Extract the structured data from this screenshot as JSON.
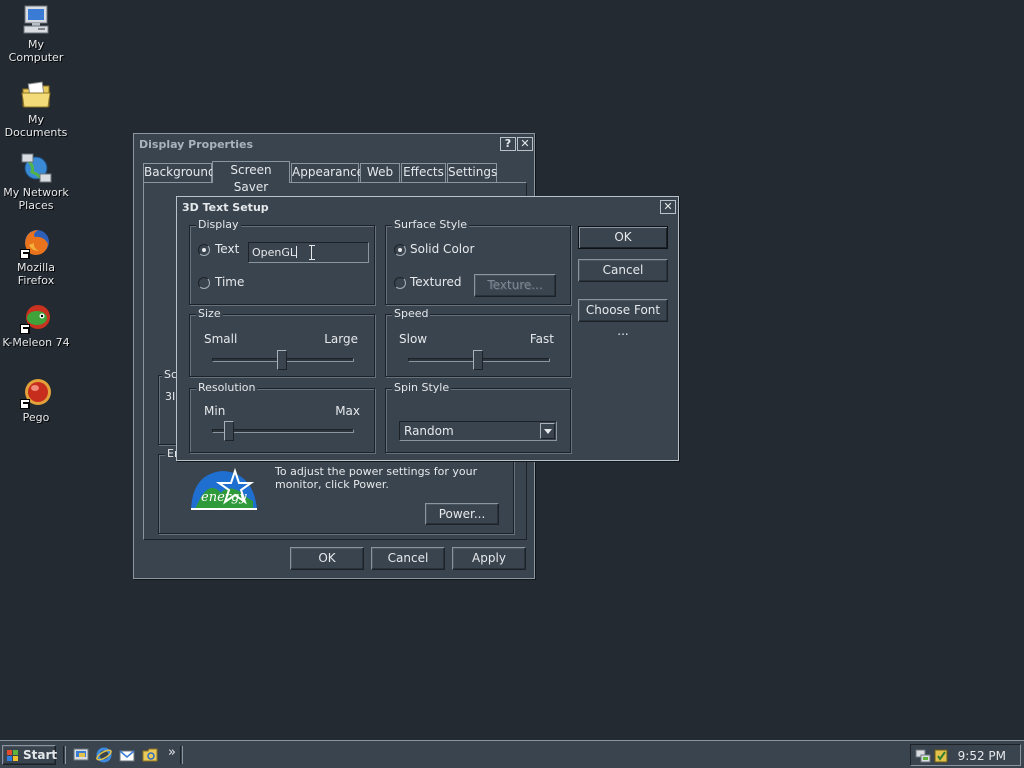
{
  "desktop": {
    "icons": [
      {
        "label": "My Computer",
        "icon": "computer-icon"
      },
      {
        "label": "My Documents",
        "icon": "documents-folder-icon"
      },
      {
        "label": "My Network Places",
        "icon": "network-places-icon"
      },
      {
        "label": "Mozilla Firefox",
        "icon": "firefox-icon"
      },
      {
        "label": "K-Meleon 74",
        "icon": "k-meleon-icon"
      },
      {
        "label": "Pego",
        "icon": "pego-icon"
      }
    ]
  },
  "display_properties": {
    "title": "Display Properties",
    "help_symbol": "?",
    "close_symbol": "✕",
    "tabs": [
      "Background",
      "Screen Saver",
      "Appearance",
      "Web",
      "Effects",
      "Settings"
    ],
    "active_tab": "Screen Saver",
    "partial_group_label": "Sc",
    "partial_value": "3I",
    "energy_group_label": "Er",
    "energy_text": "To adjust the power settings for your monitor, click Power.",
    "power_button": "Power...",
    "ok_button": "OK",
    "cancel_button": "Cancel",
    "apply_button": "Apply"
  },
  "text_setup": {
    "title": "3D Text Setup",
    "close_symbol": "✕",
    "display": {
      "label": "Display",
      "text_option": "Text",
      "time_option": "Time",
      "text_value": "OpenGL",
      "selected": "Text"
    },
    "surface": {
      "label": "Surface Style",
      "solid": "Solid Color",
      "textured": "Textured",
      "texture_button": "Texture...",
      "selected": "Solid Color"
    },
    "size": {
      "label": "Size",
      "min_label": "Small",
      "max_label": "Large",
      "value": 0.5
    },
    "speed": {
      "label": "Speed",
      "min_label": "Slow",
      "max_label": "Fast",
      "value": 0.5
    },
    "resolution": {
      "label": "Resolution",
      "min_label": "Min",
      "max_label": "Max",
      "value": 0.1
    },
    "spin": {
      "label": "Spin Style",
      "value": "Random"
    },
    "ok_button": "OK",
    "cancel_button": "Cancel",
    "font_button": "Choose Font ..."
  },
  "taskbar": {
    "start_label": "Start",
    "quick_launch": [
      "show-desktop-icon",
      "ie-icon",
      "outlook-icon",
      "explorer-icon"
    ],
    "overflow": "»",
    "clock": "9:52 PM"
  },
  "colors": {
    "desktop": "#232a31",
    "window_face": "#3a444e",
    "highlight": "#8b959f",
    "shadow": "#1c2227"
  }
}
